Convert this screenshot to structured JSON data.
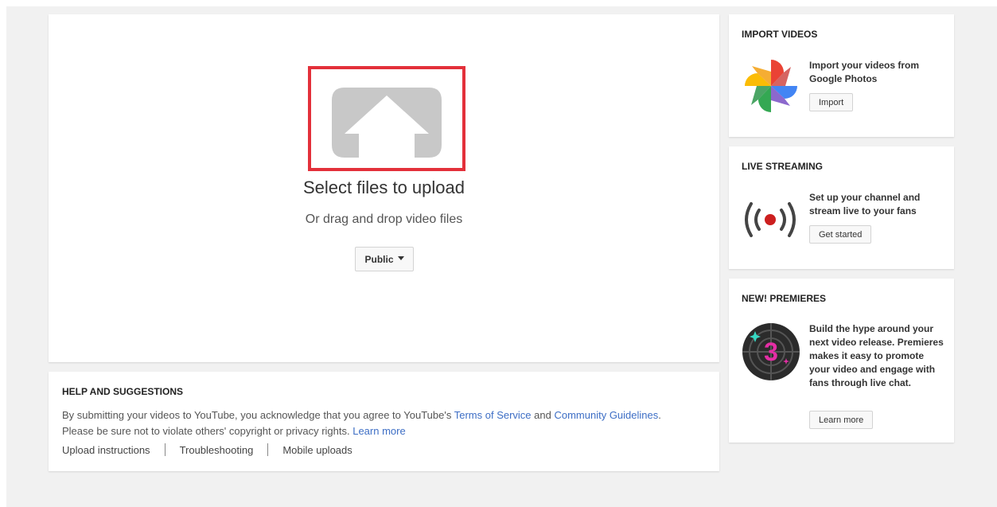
{
  "upload": {
    "title": "Select files to upload",
    "subtitle": "Or drag and drop video files",
    "privacy_label": "Public"
  },
  "help": {
    "title": "HELP AND SUGGESTIONS",
    "text_1": "By submitting your videos to YouTube, you acknowledge that you agree to YouTube's ",
    "terms_link": "Terms of Service",
    "text_and": " and ",
    "guidelines_link": "Community Guidelines",
    "text_2": ".",
    "text_3": "Please be sure not to violate others' copyright or privacy rights. ",
    "learn_more_link": "Learn more",
    "links": [
      "Upload instructions",
      "Troubleshooting",
      "Mobile uploads"
    ]
  },
  "import": {
    "title": "IMPORT VIDEOS",
    "text": "Import your videos from Google Photos",
    "button": "Import"
  },
  "live": {
    "title": "LIVE STREAMING",
    "text": "Set up your channel and stream live to your fans",
    "button": "Get started"
  },
  "premieres": {
    "title": "NEW! PREMIERES",
    "text": "Build the hype around your next video release. Premieres makes it easy to promote your video and engage with fans through live chat.",
    "button": "Learn more",
    "icon_number": "3"
  },
  "colors": {
    "highlight_border": "#e3303a",
    "link": "#3d6ec5",
    "live_dot": "#cc1f1f",
    "premieres_number": "#e52ea6"
  },
  "icons": {
    "upload": "upload-arrow-icon",
    "photos": "google-photos-icon",
    "live": "live-broadcast-icon",
    "premieres": "premieres-countdown-icon"
  }
}
